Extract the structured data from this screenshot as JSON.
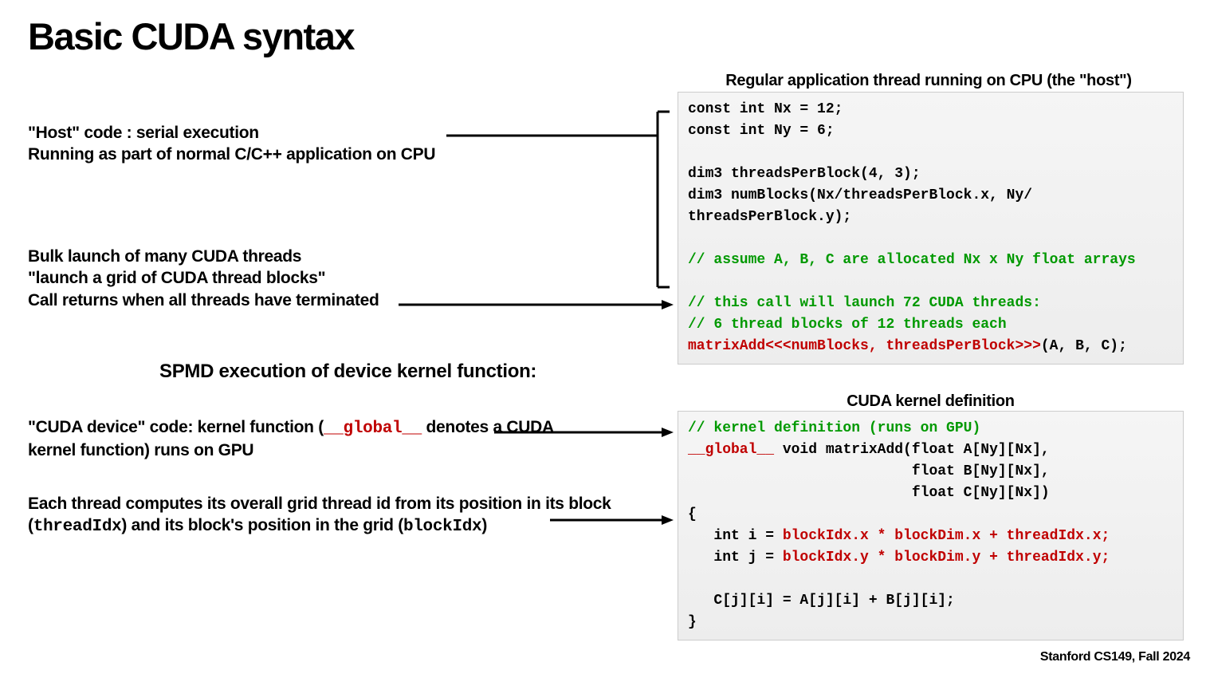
{
  "title": "Basic CUDA syntax",
  "left": {
    "host1": "\"Host\" code : serial execution",
    "host2": "Running as part of normal C/C++ application on CPU",
    "bulk1": "Bulk launch of many CUDA threads",
    "bulk2": "\"launch a grid of CUDA thread blocks\"",
    "bulk3": "Call returns when all threads have terminated",
    "spmd_heading": "SPMD execution of device kernel function:",
    "device1a": "\"CUDA device\" code: kernel function (",
    "device1_global": "__global__",
    "device1b": " denotes a CUDA",
    "device2": "kernel function) runs on GPU",
    "thread1": "Each thread computes its overall grid thread id from its position in its block",
    "thread2a": "(",
    "thread2_threadidx": "threadIdx",
    "thread2b": ") and its block's position in the grid (",
    "thread2_blockidx": "blockIdx",
    "thread2c": ")"
  },
  "right": {
    "heading1": "Regular application thread running on CPU (the \"host\")",
    "heading2": "CUDA kernel definition"
  },
  "code1": {
    "l1": "const int Nx = 12;",
    "l2": "const int Ny = 6;",
    "l3": "",
    "l4": "dim3 threadsPerBlock(4, 3);",
    "l5": "dim3 numBlocks(Nx/threadsPerBlock.x, Ny/",
    "l6": "threadsPerBlock.y);",
    "l7": "",
    "l8": "// assume A, B, C are allocated Nx x Ny float arrays",
    "l9": "",
    "l10": "// this call will launch 72 CUDA threads:",
    "l11": "// 6 thread blocks of 12 threads each",
    "l12a": "matrixAdd<<<numBlocks, threadsPerBlock>>>",
    "l12b": "(A, B, C);"
  },
  "code2": {
    "l1": "// kernel definition (runs on GPU)",
    "l2a": "__global__",
    "l2b": " void matrixAdd(float A[Ny][Nx],",
    "l3": "                          float B[Ny][Nx],",
    "l4": "                          float C[Ny][Nx])",
    "l5": "{",
    "l6a": "   int i = ",
    "l6b": "blockIdx.x * blockDim.x + threadIdx.x;",
    "l7a": "   int j = ",
    "l7b": "blockIdx.y * blockDim.y + threadIdx.y;",
    "l8": "",
    "l9": "   C[j][i] = A[j][i] + B[j][i];",
    "l10": "}"
  },
  "footer": "Stanford CS149, Fall 2024"
}
